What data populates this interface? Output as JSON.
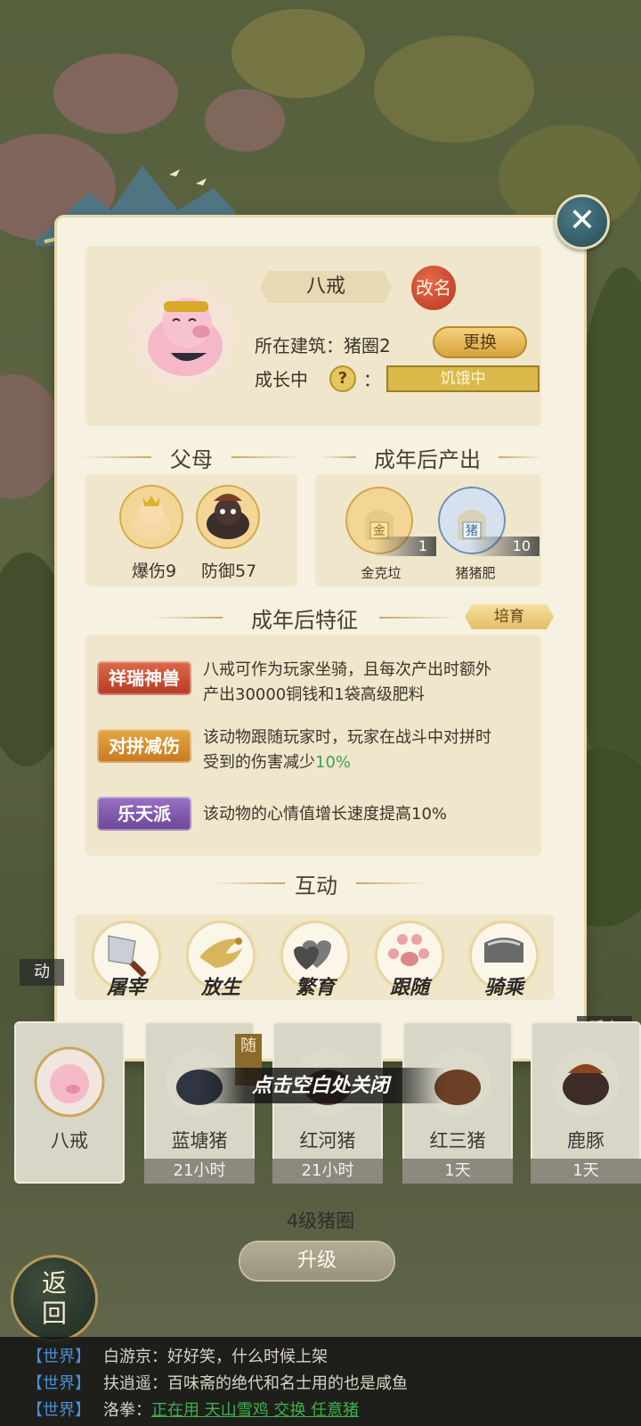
{
  "colors": {
    "panel_bg": "#f6f1e1",
    "card_bg": "#efe6cc",
    "gold": "#d6a23e",
    "rename_red": "#c9432a",
    "badge_red": "#c7472e",
    "badge_orange": "#d3902c",
    "badge_purple": "#7c54a8",
    "highlight_green": "#3aa34a",
    "chat_channel": "#4a8ed6"
  },
  "animal": {
    "name": "八戒",
    "rename_label": "改名",
    "building_label": "所在建筑：",
    "building_value": "猪圈2",
    "change_label": "更换",
    "growth_label": "成长中",
    "growth_colon": "：",
    "growth_status": "饥饿中",
    "help_icon": "?"
  },
  "parents": {
    "title": "父母",
    "items": [
      {
        "label": "爆伤9",
        "icon": "golden-pig-icon"
      },
      {
        "label": "防御57",
        "icon": "boar-icon"
      }
    ]
  },
  "output": {
    "title": "成年后产出",
    "items": [
      {
        "name": "金克垃",
        "badge": "金",
        "count": "1",
        "icon": "gold-bag-icon"
      },
      {
        "name": "猪猪肥",
        "badge": "猪",
        "count": "10",
        "icon": "fertilizer-bag-icon"
      }
    ]
  },
  "traits": {
    "title": "成年后特征",
    "train_label": "培育",
    "items": [
      {
        "badge": "祥瑞神兽",
        "line1": "八戒可作为玩家坐骑，且每次产出时额外",
        "line2": "产出30000铜钱和1袋高级肥料"
      },
      {
        "badge": "对拼减伤",
        "line1": "该动物跟随玩家时，玩家在战斗中对拼时",
        "line2_prefix": "受到的伤害减少",
        "line2_highlight": "10%"
      },
      {
        "badge": "乐天派",
        "line1": "该动物的心情值增长速度提高10%"
      }
    ]
  },
  "interact": {
    "title": "互动",
    "actions": [
      {
        "label": "屠宰",
        "icon": "cleaver-icon"
      },
      {
        "label": "放生",
        "icon": "bird-icon"
      },
      {
        "label": "繁育",
        "icon": "hearts-icon"
      },
      {
        "label": "跟随",
        "icon": "paw-icon"
      },
      {
        "label": "骑乘",
        "icon": "saddle-icon"
      }
    ]
  },
  "close_hint": "点击空白处关闭",
  "pen": {
    "slots": [
      {
        "name": "八戒",
        "time": ""
      },
      {
        "name": "蓝塘猪",
        "time": "21小时"
      },
      {
        "name": "红河猪",
        "time": "21小时"
      },
      {
        "name": "红三猪",
        "time": "1天"
      },
      {
        "name": "鹿豚",
        "time": "1天"
      }
    ],
    "follow_tag": "随",
    "right_tag": "孫中",
    "side_tab": "动",
    "title": "4级猪圈",
    "upgrade_label": "升级",
    "back_label": "返回"
  },
  "chat": [
    {
      "channel": "【世界】",
      "user": "白游京",
      "text": "好好笑，什么时候上架"
    },
    {
      "channel": "【世界】",
      "user": "扶逍遥",
      "text": "百味斋的绝代和名士用的也是咸鱼"
    },
    {
      "channel": "【世界】",
      "user": "洛拳",
      "text": "",
      "link": "正在用 天山雪鸡 交换 任意猪"
    }
  ]
}
